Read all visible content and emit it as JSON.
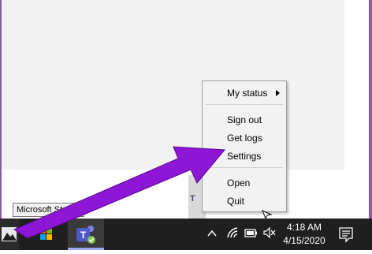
{
  "tooltip": {
    "text": "Microsoft Store"
  },
  "context_menu": {
    "items": [
      {
        "label": "My status"
      },
      {
        "label": "Sign out"
      },
      {
        "label": "Get logs"
      },
      {
        "label": "Settings"
      },
      {
        "label": "Open"
      },
      {
        "label": "Quit"
      }
    ]
  },
  "taskbar": {
    "time": "4:18 AM",
    "date": "4/15/2020"
  },
  "icons": {
    "start": "windows-logo",
    "store": "microsoft-store",
    "teams": "microsoft-teams",
    "tray": [
      "chevron-up",
      "wifi",
      "battery",
      "volume-muted",
      "action-center"
    ]
  },
  "colors": {
    "annotation_arrow": "#8e16d6",
    "taskbar": "#1f1f1f",
    "teams": "#5059c9",
    "menu_bg": "#f2f2f2"
  }
}
